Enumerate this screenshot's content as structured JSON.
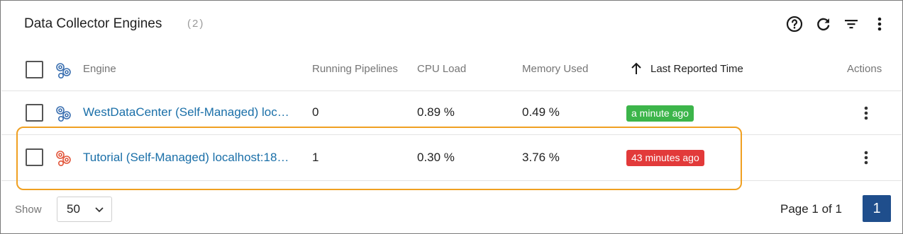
{
  "header": {
    "title": "Data Collector Engines",
    "count": "(2)",
    "icons": [
      "help-icon",
      "refresh-icon",
      "filter-icon",
      "more-vertical-icon"
    ]
  },
  "columns": {
    "engine": "Engine",
    "running": "Running Pipelines",
    "cpu": "CPU Load",
    "memory": "Memory Used",
    "last_reported": "Last Reported Time",
    "actions": "Actions",
    "sort_icon": "arrow-up-icon"
  },
  "rows": [
    {
      "engine": "WestDataCenter (Self-Managed) loc…",
      "running": "0",
      "cpu": "0.89 %",
      "memory": "0.49 %",
      "last_reported": "a minute ago",
      "status_color": "#3cb54a",
      "icon_color": "#3a6fb0"
    },
    {
      "engine": "Tutorial (Self-Managed) localhost:18…",
      "running": "1",
      "cpu": "0.30 %",
      "memory": "3.76 %",
      "last_reported": "43 minutes ago",
      "status_color": "#e23a3a",
      "icon_color": "#e2563b"
    }
  ],
  "footer": {
    "show_label": "Show",
    "page_size": "50",
    "page_info": "Page 1 of 1",
    "current_page": "1"
  },
  "colors": {
    "link": "#1a6fa8",
    "highlight": "#f0a021",
    "page_button": "#1f4e8c"
  }
}
